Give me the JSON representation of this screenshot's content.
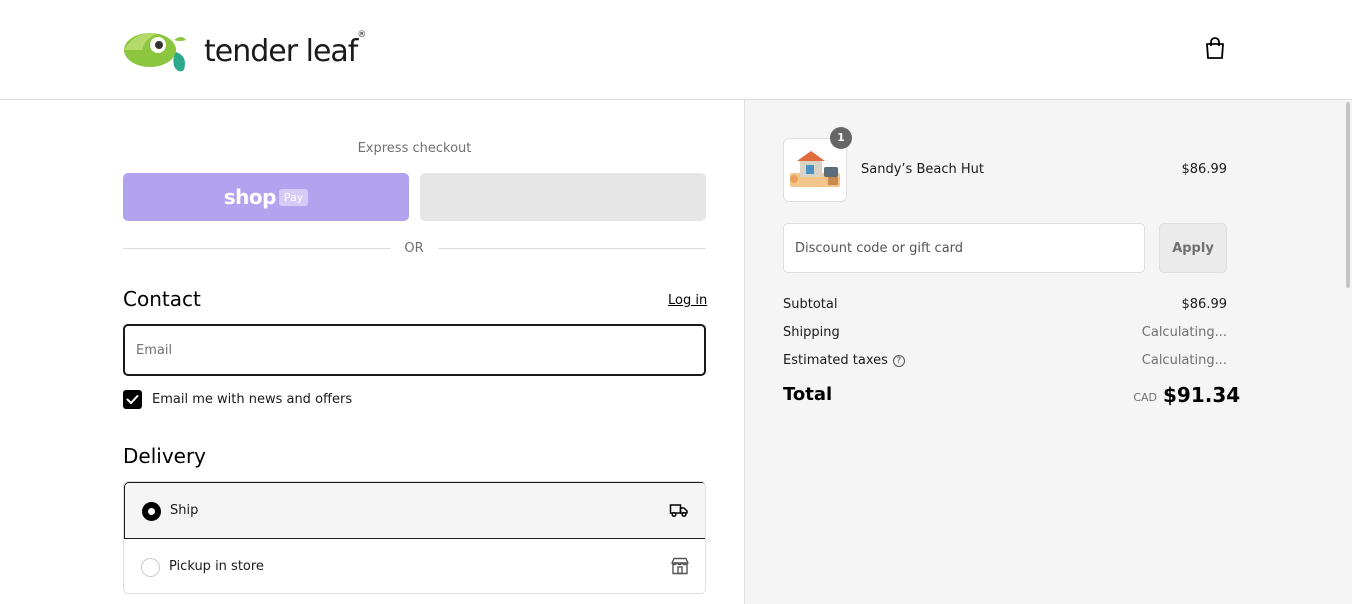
{
  "header": {
    "brand": "tender leaf",
    "brand_mark": "®",
    "cart_icon": "shopping-bag-icon"
  },
  "checkout": {
    "express_label": "Express checkout",
    "shop_pay_text": "shop",
    "shop_pay_badge": "Pay",
    "or_text": "OR",
    "contact_heading": "Contact",
    "login_label": "Log in",
    "email_placeholder": "Email",
    "newsletter_label": "Email me with news and offers",
    "newsletter_checked": true,
    "delivery_heading": "Delivery",
    "delivery_options": [
      {
        "label": "Ship",
        "icon": "truck-icon",
        "selected": true
      },
      {
        "label": "Pickup in store",
        "icon": "store-icon",
        "selected": false
      }
    ]
  },
  "summary": {
    "item": {
      "name": "Sandy’s Beach Hut",
      "price": "$86.99",
      "quantity": "1"
    },
    "discount_placeholder": "Discount code or gift card",
    "apply_label": "Apply",
    "subtotal_label": "Subtotal",
    "subtotal_value": "$86.99",
    "shipping_label": "Shipping",
    "shipping_value": "Calculating...",
    "taxes_label": "Estimated taxes",
    "taxes_value": "Calculating...",
    "total_label": "Total",
    "currency": "CAD",
    "total_value": "$91.34"
  },
  "colors": {
    "shop_pay": "#b3a3ee",
    "logo_green": "#8cc63f",
    "logo_teal": "#2aa98c"
  }
}
